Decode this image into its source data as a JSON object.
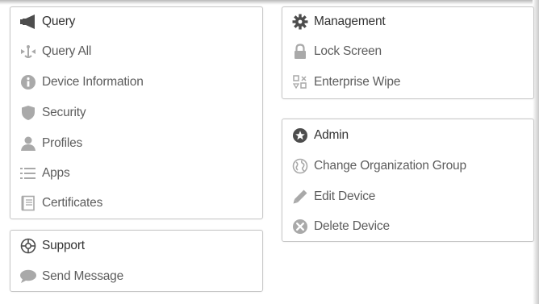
{
  "colors": {
    "icon_dark": "#4d4d4d",
    "icon_light": "#a9a9a9",
    "text_header": "#333333",
    "text_item": "#5d5d5d",
    "border": "#c8c8c8"
  },
  "device_panel": {
    "items": [
      {
        "label": "Query",
        "icon": "megaphone-icon"
      },
      {
        "label": "Query All",
        "icon": "query-all-icon"
      },
      {
        "label": "Device Information",
        "icon": "info-icon"
      },
      {
        "label": "Security",
        "icon": "shield-icon"
      },
      {
        "label": "Profiles",
        "icon": "user-icon"
      },
      {
        "label": "Apps",
        "icon": "list-icon"
      },
      {
        "label": "Certificates",
        "icon": "certificate-icon"
      }
    ]
  },
  "support_panel": {
    "title": "Support",
    "title_icon": "lifebuoy-icon",
    "items": [
      {
        "label": "Send Message",
        "icon": "speech-bubble-icon"
      }
    ]
  },
  "management_panel": {
    "title": "Management",
    "title_icon": "gear-icon",
    "items": [
      {
        "label": "Lock Screen",
        "icon": "lock-icon"
      },
      {
        "label": "Enterprise Wipe",
        "icon": "enterprise-wipe-icon"
      }
    ]
  },
  "admin_panel": {
    "title": "Admin",
    "title_icon": "star-badge-icon",
    "items": [
      {
        "label": "Change Organization Group",
        "icon": "globe-icon"
      },
      {
        "label": "Edit Device",
        "icon": "pencil-icon"
      },
      {
        "label": "Delete Device",
        "icon": "delete-circle-icon"
      }
    ]
  }
}
